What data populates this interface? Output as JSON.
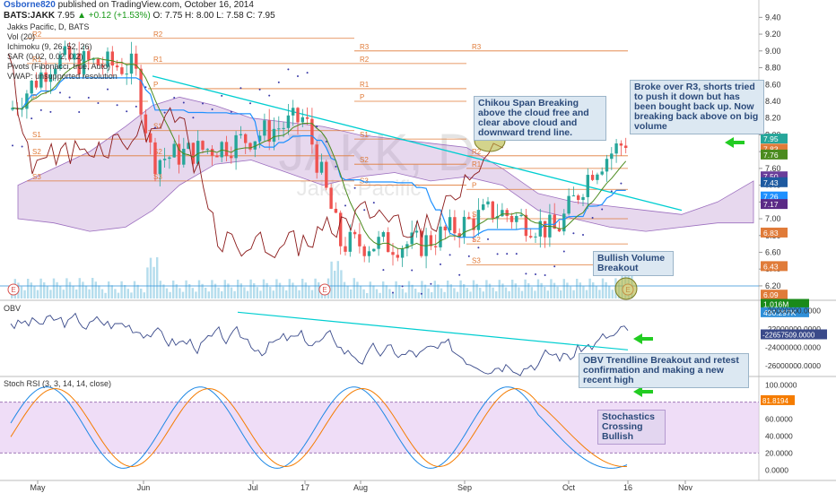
{
  "header": {
    "user": "Osborne820",
    "published": "published on TradingView.com, October 16, 2014",
    "ticker": "BATS:JAKK",
    "last": "7.95",
    "change": "▲ +0.12 (+1.53%)",
    "ohlc": "O: 7.75 H: 8.00 L: 7.58 C: 7.95"
  },
  "legend": {
    "title": "Jakks Pacific, D, BATS",
    "vol": "Vol (20)",
    "ichimoku": "Ichimoku (9, 26, 52, 26)",
    "sar": "SAR (0.02, 0.02, 0.2)",
    "pivots": "Pivots (Fibonacci, true, Auto)",
    "vwap": "VWAP: unsupported resolution",
    "watermark_ticker": "JAKK, D",
    "watermark_name": "Jakks Pacific"
  },
  "colors": {
    "up": "#26a69a",
    "down": "#ef5350",
    "cloud": "#b98fcf",
    "tenkan": "#1e90ff",
    "kijun": "#8b1a1a",
    "chikou": "#4b8b1e",
    "trend": "#00ced1",
    "pivot": "#e07b39",
    "annotation_arrow": "#22cc22",
    "stoch_k": "#1e88e5",
    "stoch_d": "#f57c00"
  },
  "annotations": {
    "chikou": "Chikou Span Breaking above the cloud free and clear above cloud and downward trend line.",
    "r3": "Broke over R3, shorts tried to push it down but has been bought back up. Now breaking back above on big volume",
    "volume": "Bullish Volume Breakout",
    "obv": "OBV Trendline Breakout and retest confirmation and making a new recent high",
    "stoch": "Stochastics Crossing Bullish"
  },
  "main_axis": {
    "ticks": [
      "9.40",
      "9.20",
      "9.00",
      "8.80",
      "8.60",
      "8.40",
      "8.20",
      "8.00",
      "7.80",
      "7.60",
      "7.40",
      "7.20",
      "7.00",
      "6.80",
      "6.60",
      "6.40",
      "6.20"
    ],
    "tick_values": [
      9.4,
      9.2,
      9.0,
      8.8,
      8.6,
      8.4,
      8.2,
      8.0,
      7.8,
      7.6,
      7.4,
      7.2,
      7.0,
      6.8,
      6.6,
      6.4,
      6.2
    ],
    "badges": [
      {
        "text": "7.95",
        "value": 7.95,
        "color": "#26a69a"
      },
      {
        "text": "7.83",
        "value": 7.83,
        "color": "#e07b39"
      },
      {
        "text": "7.76",
        "value": 7.76,
        "color": "#4b8b1e"
      },
      {
        "text": "7.50",
        "value": 7.5,
        "color": "#6a3d9a"
      },
      {
        "text": "7.43",
        "value": 7.43,
        "color": "#1e5aa0"
      },
      {
        "text": "7.26",
        "value": 7.26,
        "color": "#1e90ff"
      },
      {
        "text": "7.17",
        "value": 7.17,
        "color": "#5b2a86"
      },
      {
        "text": "6.83",
        "value": 6.83,
        "color": "#e07b39"
      },
      {
        "text": "6.43",
        "value": 6.43,
        "color": "#e07b39"
      },
      {
        "text": "6.09",
        "value": 6.09,
        "color": "#e07b39"
      },
      {
        "text": "1.016M",
        "value": 5.98,
        "color": "#1a8a1a"
      },
      {
        "text": "490.297K",
        "value": 5.88,
        "color": "#2f8fd8"
      }
    ]
  },
  "obv_axis": {
    "ticks": [
      "-20000000.0000",
      "-22000000.0000",
      "-24000000.0000",
      "-26000000.0000"
    ],
    "tick_values": [
      -20000000,
      -22000000,
      -24000000,
      -26000000
    ],
    "badge": "-22657509.0000",
    "badge_value": -22657509
  },
  "stoch_axis": {
    "ticks": [
      "100.0000",
      "80.0000",
      "60.0000",
      "40.0000",
      "20.0000",
      "0.0000"
    ],
    "tick_values": [
      100,
      80,
      60,
      40,
      20,
      0
    ],
    "badge": "81.8194",
    "badge_value": 81.8194
  },
  "panes": {
    "obv_label": "OBV",
    "stoch_label": "Stoch RSI (3, 3, 14, 14, close)"
  },
  "pivot_labels": [
    {
      "text": "R2"
    },
    {
      "text": "R1"
    },
    {
      "text": "P"
    },
    {
      "text": "S1"
    },
    {
      "text": "S2"
    },
    {
      "text": "S3"
    },
    {
      "text": "R2"
    },
    {
      "text": "R1"
    },
    {
      "text": "P"
    },
    {
      "text": "S1"
    },
    {
      "text": "S2"
    },
    {
      "text": "S3"
    },
    {
      "text": "R3"
    },
    {
      "text": "R2"
    },
    {
      "text": "R1"
    },
    {
      "text": "P"
    },
    {
      "text": "S1"
    },
    {
      "text": "S2"
    },
    {
      "text": "S3"
    },
    {
      "text": "R3"
    },
    {
      "text": "R2"
    },
    {
      "text": "R1"
    },
    {
      "text": "P"
    },
    {
      "text": "S1"
    },
    {
      "text": "S2"
    },
    {
      "text": "S3"
    }
  ],
  "x_axis": [
    "May",
    "Jun",
    "Jul",
    "17",
    "Aug",
    "Sep",
    "Oct",
    "16",
    "Nov"
  ],
  "earnings_marker": "E",
  "chart_data": [
    {
      "type": "candlestick",
      "x_range": [
        "2014-04-25",
        "2014-11-20"
      ],
      "ylim": [
        5.9,
        9.5
      ],
      "ohlc_sample": [
        {
          "date": "2014-04-28",
          "o": 8.3,
          "h": 8.55,
          "l": 8.05,
          "c": 8.4
        },
        {
          "date": "2014-05-12",
          "o": 8.9,
          "h": 9.05,
          "l": 8.7,
          "c": 8.95
        },
        {
          "date": "2014-05-27",
          "o": 8.65,
          "h": 8.95,
          "l": 8.55,
          "c": 8.85
        },
        {
          "date": "2014-06-02",
          "o": 8.4,
          "h": 8.55,
          "l": 7.45,
          "c": 7.7
        },
        {
          "date": "2014-07-01",
          "o": 7.9,
          "h": 8.1,
          "l": 7.8,
          "c": 7.95
        },
        {
          "date": "2014-07-17",
          "o": 8.15,
          "h": 8.45,
          "l": 7.95,
          "c": 8.2
        },
        {
          "date": "2014-07-31",
          "o": 7.25,
          "h": 7.4,
          "l": 6.35,
          "c": 6.6
        },
        {
          "date": "2014-08-15",
          "o": 6.65,
          "h": 6.85,
          "l": 6.55,
          "c": 6.7
        },
        {
          "date": "2014-09-02",
          "o": 7.05,
          "h": 7.3,
          "l": 6.95,
          "c": 7.15
        },
        {
          "date": "2014-09-22",
          "o": 6.9,
          "h": 7.0,
          "l": 6.65,
          "c": 6.8
        },
        {
          "date": "2014-10-06",
          "o": 7.5,
          "h": 7.95,
          "l": 7.4,
          "c": 7.85
        },
        {
          "date": "2014-10-16",
          "o": 7.75,
          "h": 8.0,
          "l": 7.58,
          "c": 7.95
        }
      ],
      "volume": {
        "last": 1016000,
        "average": 490297
      },
      "series": [
        {
          "name": "Vol (20)"
        },
        {
          "name": "Ichimoku (9, 26, 52, 26)"
        },
        {
          "name": "SAR (0.02, 0.02, 0.2)"
        },
        {
          "name": "Pivots (Fibonacci, true, Auto)"
        }
      ]
    },
    {
      "type": "line",
      "series": [
        {
          "name": "OBV",
          "last": -22657509
        }
      ],
      "ylim": [
        -27000000,
        -19000000
      ]
    },
    {
      "type": "line",
      "series": [
        {
          "name": "Stoch RSI (3, 3, 14, 14, close)",
          "last": 81.8194
        }
      ],
      "ylim": [
        -5,
        105
      ]
    }
  ]
}
